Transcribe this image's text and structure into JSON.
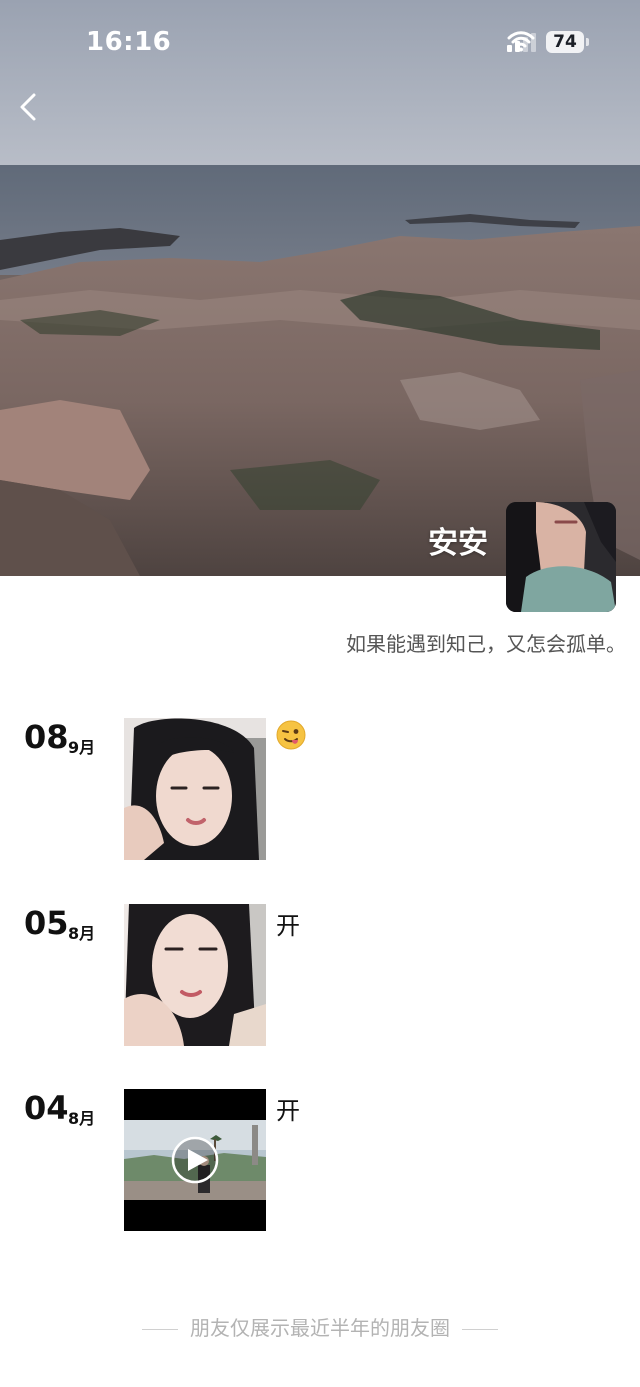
{
  "status_bar": {
    "time": "16:16",
    "battery": "74"
  },
  "profile": {
    "name": "安安",
    "signature": "如果能遇到知己，又怎会孤单。"
  },
  "posts": [
    {
      "day": "08",
      "month": "9月",
      "caption": "",
      "media": "photo",
      "emoji": "winking-tongue-emoji"
    },
    {
      "day": "05",
      "month": "8月",
      "caption": "开",
      "media": "photo"
    },
    {
      "day": "04",
      "month": "8月",
      "caption": "开",
      "media": "video"
    }
  ],
  "footer": {
    "note": "朋友仅展示最近半年的朋友圈"
  },
  "icons": {
    "back": "chevron-left-icon",
    "signal": "cellular-signal-icon",
    "wifi": "wifi-icon",
    "battery": "battery-icon",
    "play": "play-icon"
  },
  "colors": {
    "text_primary": "#111111",
    "text_secondary": "#555555",
    "footer_text": "#b3b3b3"
  }
}
